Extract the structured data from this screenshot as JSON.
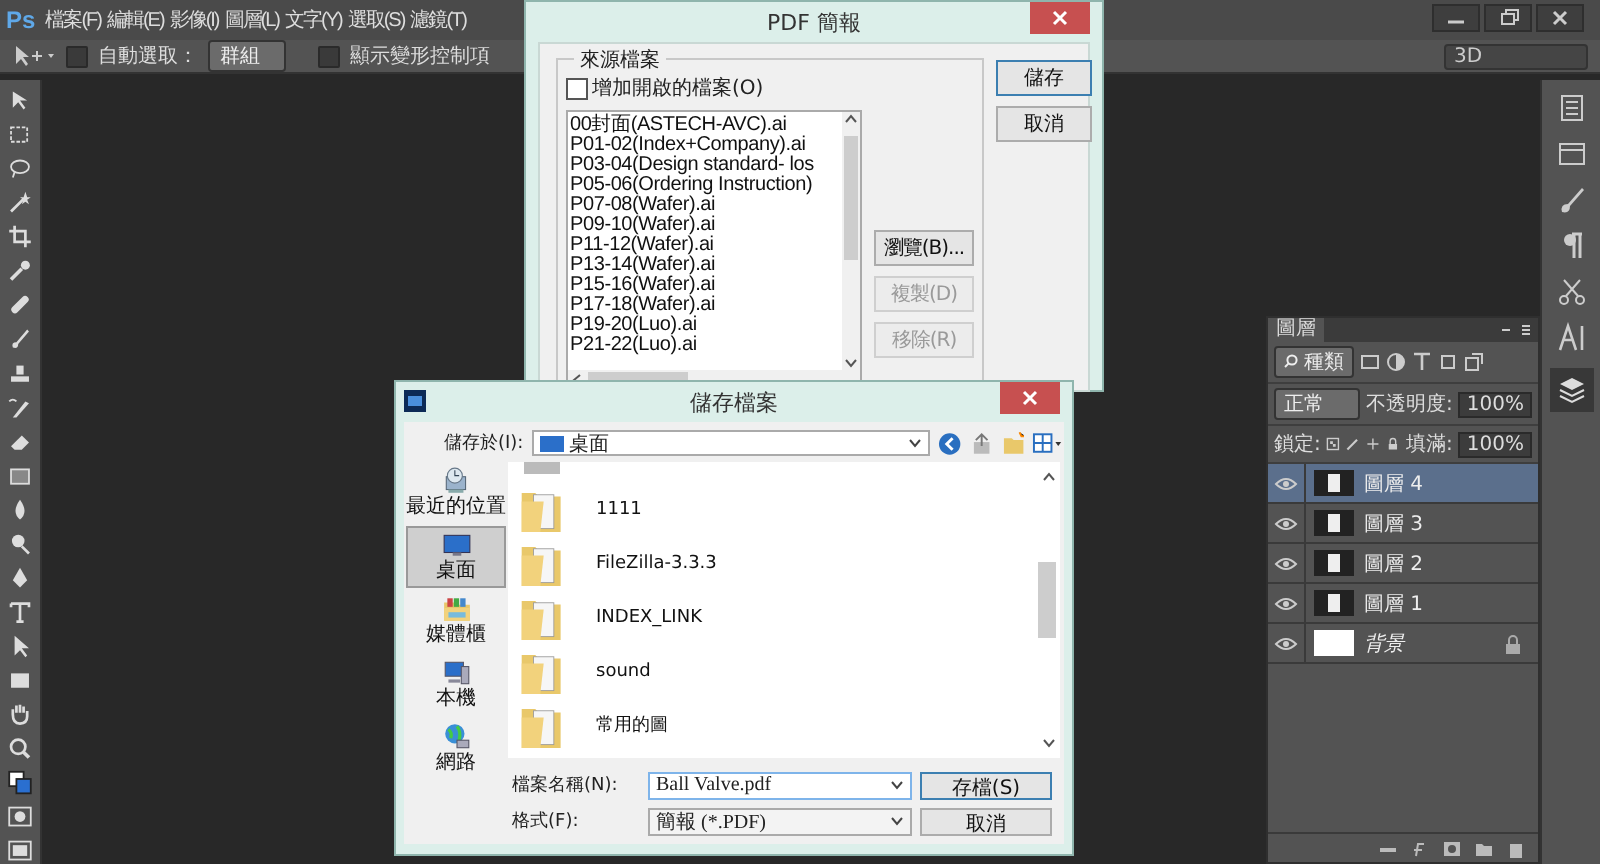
{
  "menu_bar": {
    "app_logo": "Ps",
    "items": [
      "檔案(F)",
      "編輯(E)",
      "影像(I)",
      "圖層(L)",
      "文字(Y)",
      "選取(S)",
      "濾鏡(T)"
    ]
  },
  "options_bar": {
    "auto_select": {
      "label": "自動選取：",
      "checked": false
    },
    "auto_select_target": "群組",
    "transform_controls": {
      "label": "顯示變形控制項",
      "checked": false
    },
    "mode_3d": "3D"
  },
  "pdf_dialog": {
    "title": "PDF 簡報",
    "source_group": "來源檔案",
    "add_open_files": {
      "label": "增加開啟的檔案(O)",
      "checked": false
    },
    "files": [
      "00封面(ASTECH-AVC).ai",
      "P01-02(Index+Company).ai",
      "P03-04(Design standard- los",
      "P05-06(Ordering Instruction)",
      "P07-08(Wafer).ai",
      "P09-10(Wafer).ai",
      "P11-12(Wafer).ai",
      "P13-14(Wafer).ai",
      "P15-16(Wafer).ai",
      "P17-18(Wafer).ai",
      "P19-20(Luo).ai",
      "P21-22(Luo).ai"
    ],
    "list_buttons": [
      {
        "label": "瀏覽(B)...",
        "disabled": false
      },
      {
        "label": "複製(D)",
        "disabled": true
      },
      {
        "label": "移除(R)",
        "disabled": true
      }
    ],
    "buttons": [
      "儲存",
      "取消"
    ]
  },
  "save_dialog": {
    "title": "儲存檔案",
    "save_in_label": "儲存於(I):",
    "save_in": "桌面",
    "places": [
      {
        "label": "最近的位置",
        "kind": "recent",
        "selected": false
      },
      {
        "label": "桌面",
        "kind": "desktop",
        "selected": true
      },
      {
        "label": "媒體櫃",
        "kind": "library",
        "selected": false
      },
      {
        "label": "本機",
        "kind": "computer",
        "selected": false
      },
      {
        "label": "網路",
        "kind": "network",
        "selected": false
      }
    ],
    "files": [
      "1111",
      "FileZilla-3.3.3",
      "INDEX_LINK",
      "sound",
      "常用的圖"
    ],
    "file_name_label": "檔案名稱(N):",
    "file_name": "Ball Valve.pdf",
    "format_label": "格式(F):",
    "format": "簡報 (*.PDF)",
    "buttons": [
      "存檔(S)",
      "取消"
    ]
  },
  "layers_panel": {
    "tab": "圖層",
    "filter": "種類",
    "blend_mode": "正常",
    "opacity_label": "不透明度:",
    "opacity": "100%",
    "lock_label": "鎖定:",
    "fill_label": "填滿:",
    "fill": "100%",
    "layers": [
      {
        "name": "圖層 4",
        "kind": "layer",
        "selected": true,
        "visible": true,
        "locked": false
      },
      {
        "name": "圖層 3",
        "kind": "layer",
        "selected": false,
        "visible": true,
        "locked": false
      },
      {
        "name": "圖層 2",
        "kind": "layer",
        "selected": false,
        "visible": true,
        "locked": false
      },
      {
        "name": "圖層 1",
        "kind": "layer",
        "selected": false,
        "visible": true,
        "locked": false
      },
      {
        "name": "背景",
        "kind": "background",
        "selected": false,
        "visible": true,
        "locked": true
      }
    ]
  }
}
